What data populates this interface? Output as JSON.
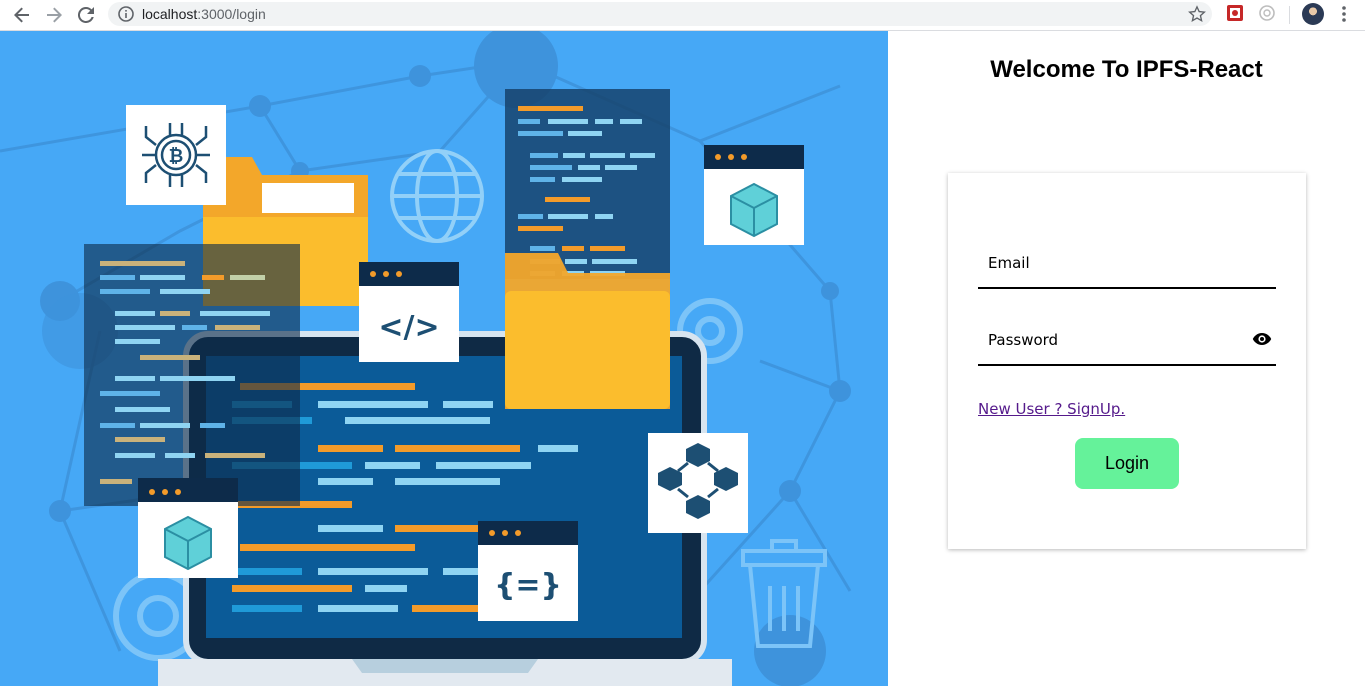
{
  "browser": {
    "url_host": "localhost",
    "url_path": ":3000/login"
  },
  "page": {
    "welcome_title": "Welcome To IPFS-React"
  },
  "form": {
    "email_placeholder": "Email",
    "password_placeholder": "Password",
    "signup_link": "New User ? SignUp.",
    "login_label": "Login"
  },
  "illustration": {
    "code_tag": "</>",
    "braces_tag": "{=}"
  },
  "colors": {
    "hero_bg": "#46a8f6",
    "login_button": "#65f29a",
    "link": "#551a8b"
  },
  "icons": [
    "back-arrow-icon",
    "forward-arrow-icon",
    "reload-icon",
    "info-icon",
    "star-icon",
    "extension-icon",
    "avatar",
    "more-vert-icon",
    "eye-icon"
  ]
}
